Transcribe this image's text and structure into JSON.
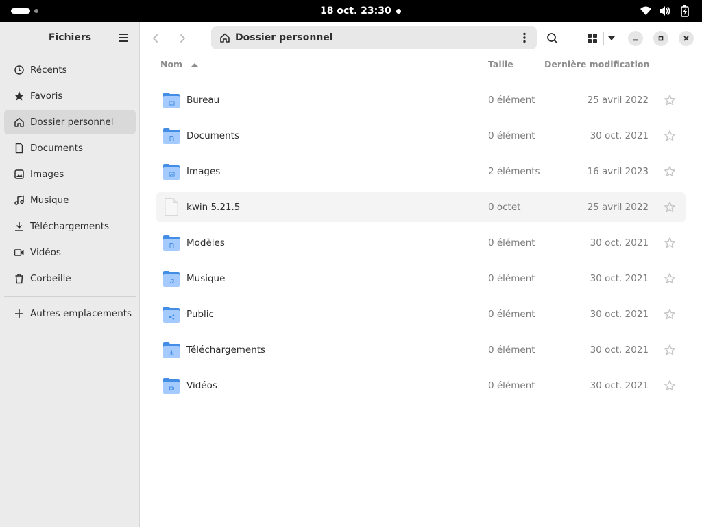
{
  "topbar": {
    "clock": "18 oct.  23:30"
  },
  "sidebar": {
    "title": "Fichiers",
    "items": [
      {
        "label": "Récents",
        "icon": "clock-icon"
      },
      {
        "label": "Favoris",
        "icon": "star-icon"
      },
      {
        "label": "Dossier personnel",
        "icon": "home-icon",
        "active": true
      },
      {
        "label": "Documents",
        "icon": "document-icon"
      },
      {
        "label": "Images",
        "icon": "image-icon"
      },
      {
        "label": "Musique",
        "icon": "music-icon"
      },
      {
        "label": "Téléchargements",
        "icon": "download-icon"
      },
      {
        "label": "Vidéos",
        "icon": "video-icon"
      },
      {
        "label": "Corbeille",
        "icon": "trash-icon"
      }
    ],
    "other_locations": {
      "label": "Autres emplacements",
      "icon": "plus-icon"
    }
  },
  "pathbar": {
    "label": "Dossier personnel"
  },
  "columns": {
    "name": "Nom",
    "size": "Taille",
    "modified": "Dernière modification"
  },
  "files": [
    {
      "name": "Bureau",
      "size": "0 élément",
      "date": "25 avril 2022",
      "type": "folder",
      "emblem": "desktop"
    },
    {
      "name": "Documents",
      "size": "0 élément",
      "date": "30 oct. 2021",
      "type": "folder",
      "emblem": "document"
    },
    {
      "name": "Images",
      "size": "2 éléments",
      "date": "16 avril 2023",
      "type": "folder",
      "emblem": "image"
    },
    {
      "name": "kwin 5.21.5",
      "size": "0 octet",
      "date": "25 avril 2022",
      "type": "file",
      "emblem": "none"
    },
    {
      "name": "Modèles",
      "size": "0 élément",
      "date": "30 oct. 2021",
      "type": "folder",
      "emblem": "template"
    },
    {
      "name": "Musique",
      "size": "0 élément",
      "date": "30 oct. 2021",
      "type": "folder",
      "emblem": "music"
    },
    {
      "name": "Public",
      "size": "0 élément",
      "date": "30 oct. 2021",
      "type": "folder",
      "emblem": "share"
    },
    {
      "name": "Téléchargements",
      "size": "0 élément",
      "date": "30 oct. 2021",
      "type": "folder",
      "emblem": "download"
    },
    {
      "name": "Vidéos",
      "size": "0 élément",
      "date": "30 oct. 2021",
      "type": "folder",
      "emblem": "video"
    }
  ],
  "colors": {
    "folder_back": "#438de6",
    "folder_front": "#a4cafe",
    "sidebar_bg": "#ebebeb",
    "active_item": "#d9d9d9"
  }
}
